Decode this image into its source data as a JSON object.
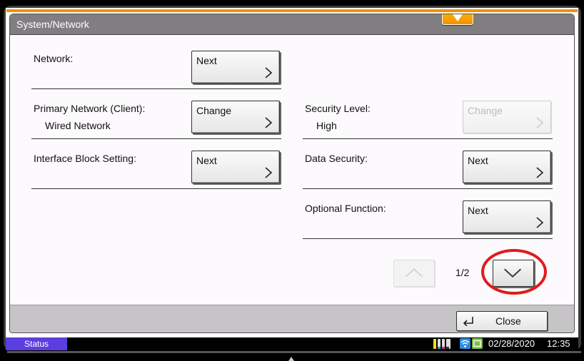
{
  "window": {
    "title": "System/Network"
  },
  "left_column": [
    {
      "label": "Network:",
      "value": "",
      "button": "Next",
      "button_enabled": true
    },
    {
      "label": "Primary Network (Client):",
      "value": "Wired Network",
      "button": "Change",
      "button_enabled": true
    },
    {
      "label": "Interface Block Setting:",
      "value": "",
      "button": "Next",
      "button_enabled": true
    }
  ],
  "right_column": [
    {
      "label": "Security Level:",
      "value": "High",
      "button": "Change",
      "button_enabled": false
    },
    {
      "label": "Data Security:",
      "value": "",
      "button": "Next",
      "button_enabled": true
    },
    {
      "label": "Optional Function:",
      "value": "",
      "button": "Next",
      "button_enabled": true
    }
  ],
  "pagination": {
    "current": 1,
    "total": 2,
    "text": "1/2"
  },
  "footer": {
    "close_label": "Close"
  },
  "statusbar": {
    "status_label": "Status",
    "date": "02/28/2020",
    "time": "12:35",
    "toner_colors": [
      "#f4e200",
      "#1aa0e0",
      "#e0268a",
      "#333333"
    ],
    "network_icon_color": "#2a8ae6",
    "device_icon_color": "#7cc242"
  },
  "colors": {
    "accent": "#f39200",
    "highlight": "#e3191c",
    "status": "#5b3ee0"
  }
}
